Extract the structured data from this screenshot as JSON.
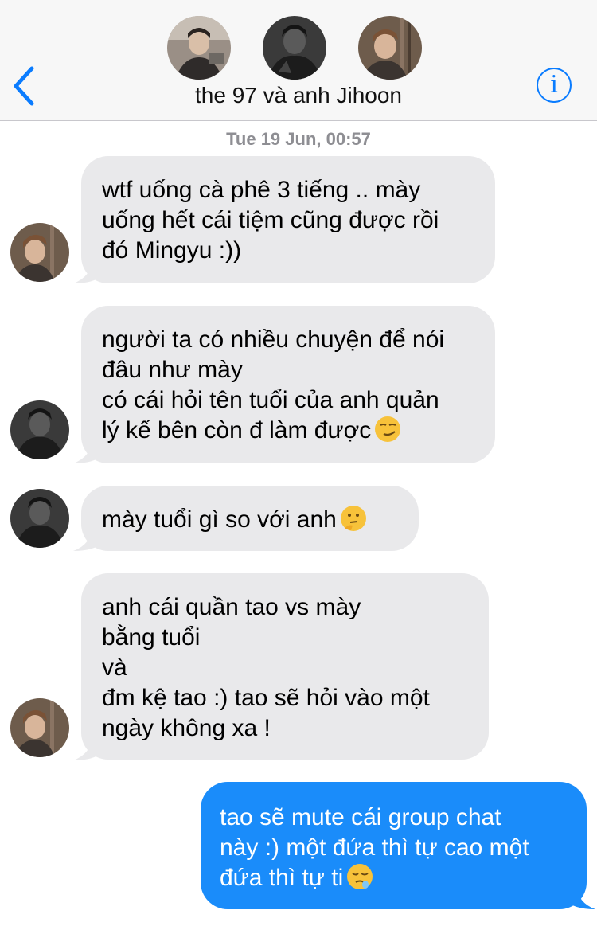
{
  "header": {
    "title": "the 97 và anh Jihoon",
    "back_icon": "chevron-left-icon",
    "info_icon": "info-icon",
    "info_glyph": "i",
    "avatars": [
      "group-member-avatar",
      "group-member-avatar",
      "group-member-avatar"
    ]
  },
  "timestamp": "Tue 19 Jun, 00:57",
  "messages": [
    {
      "direction": "incoming",
      "lines": [
        "wtf uống cà phê 3 tiếng .. mày",
        "uống hết cái tiệm cũng được rồi",
        "đó Mingyu :))"
      ]
    },
    {
      "direction": "incoming",
      "lines": [
        "người ta có nhiều chuyện để nói",
        "đâu như mày",
        "có cái hỏi tên tuổi của anh quản",
        "lý kế bên còn đ làm được"
      ],
      "emoji": "smirking-face-emoji"
    },
    {
      "direction": "incoming",
      "lines": [
        "mày tuổi gì so với anh"
      ],
      "emoji": "thinking-face-emoji"
    },
    {
      "direction": "incoming",
      "lines": [
        "anh cái quần tao vs mày",
        "bằng tuổi",
        "và",
        "đm kệ tao :) tao sẽ hỏi vào một",
        "ngày không xa !"
      ]
    },
    {
      "direction": "outgoing",
      "lines": [
        "tao sẽ mute cái group chat",
        "này :) một đứa thì tự cao một",
        "đứa thì tự ti"
      ],
      "emoji": "sleepy-face-emoji"
    }
  ],
  "colors": {
    "accent": "#0a7cff",
    "incoming_bubble": "#e9e9eb",
    "outgoing_bubble": "#1a8cfa",
    "timestamp": "#8e8e93"
  }
}
